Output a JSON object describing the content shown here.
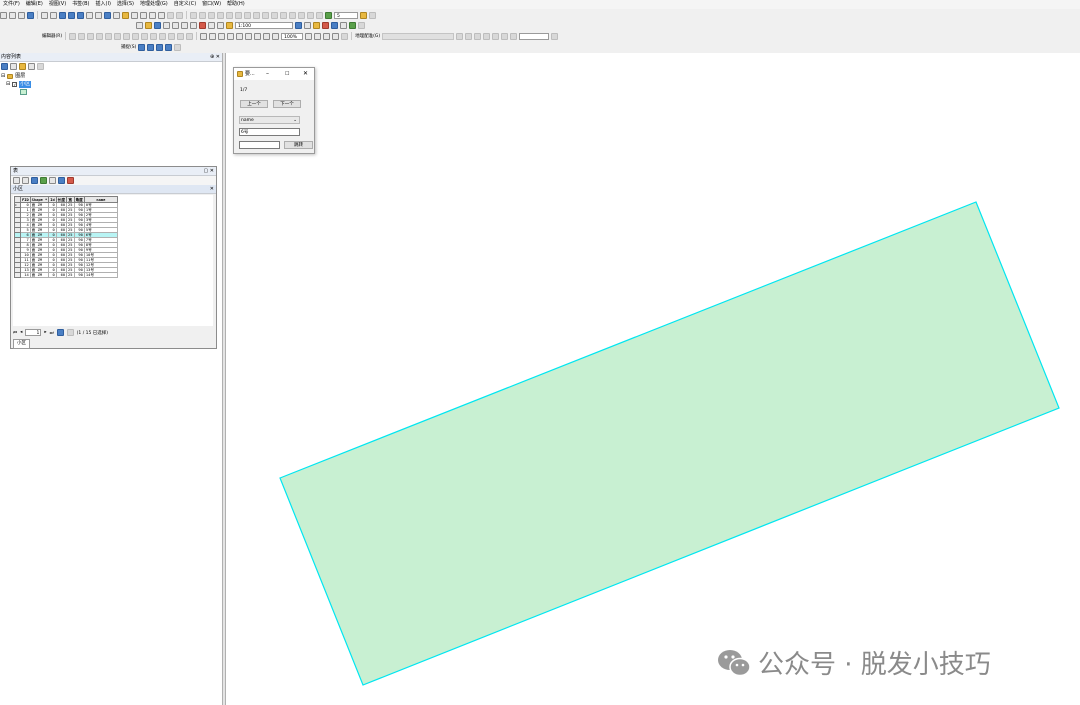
{
  "menu": [
    "文件(F)",
    "编辑(E)",
    "视图(V)",
    "书签(B)",
    "插入(I)",
    "选择(S)",
    "地理处理(G)",
    "自定义(C)",
    "窗口(W)",
    "帮助(H)"
  ],
  "toolbar": {
    "scale_value": "5",
    "scale_combo": "1:100",
    "editor_label": "编辑器(R)",
    "percent_value": "100%",
    "georef_label": "地理配准(G)",
    "capture_label": "捕捉(S)"
  },
  "toc": {
    "title": "内容列表",
    "group_label": "图层",
    "layer_label": "小区"
  },
  "table_window": {
    "title": "表",
    "layer_tab": "小区",
    "columns": [
      "FID",
      "Shape *",
      "Id",
      "长度",
      "宽",
      "角度",
      "name"
    ],
    "rows": [
      [
        "0",
        "面 ZM",
        "0",
        "60",
        "25",
        "90",
        "0号"
      ],
      [
        "1",
        "面 ZM",
        "0",
        "60",
        "25",
        "90",
        "1号"
      ],
      [
        "2",
        "面 ZM",
        "0",
        "60",
        "25",
        "90",
        "2号"
      ],
      [
        "3",
        "面 ZM",
        "0",
        "60",
        "25",
        "90",
        "3号"
      ],
      [
        "4",
        "面 ZM",
        "0",
        "60",
        "25",
        "90",
        "4号"
      ],
      [
        "5",
        "面 ZM",
        "0",
        "60",
        "25",
        "90",
        "5号"
      ],
      [
        "6",
        "面 ZM",
        "0",
        "60",
        "25",
        "90",
        "6号"
      ],
      [
        "7",
        "面 ZM",
        "0",
        "60",
        "25",
        "90",
        "7号"
      ],
      [
        "8",
        "面 ZM",
        "0",
        "60",
        "25",
        "90",
        "8号"
      ],
      [
        "9",
        "面 ZM",
        "0",
        "60",
        "25",
        "90",
        "9号"
      ],
      [
        "10",
        "面 ZM",
        "0",
        "60",
        "25",
        "90",
        "10号"
      ],
      [
        "11",
        "面 ZM",
        "0",
        "60",
        "25",
        "90",
        "11号"
      ],
      [
        "12",
        "面 ZM",
        "0",
        "60",
        "25",
        "90",
        "12号"
      ],
      [
        "13",
        "面 ZM",
        "0",
        "60",
        "25",
        "90",
        "13号"
      ],
      [
        "14",
        "面 ZM",
        "0",
        "60",
        "25",
        "90",
        "14号"
      ]
    ],
    "highlight_row": 6,
    "nav_record": "1",
    "status": "(1 / 15 已选择)"
  },
  "dialog": {
    "title": "要...",
    "counter": "1/7",
    "prev_label": "上一个",
    "next_label": "下一个",
    "field_select": "name",
    "value_text": "6号",
    "jump_label": "跳转",
    "jump_input": ""
  },
  "watermark": {
    "text": "公众号 · 脱发小技巧"
  },
  "colors": {
    "polygon_fill": "#c8f0d2",
    "polygon_stroke": "#00e6f0",
    "selection_row": "#b8f4f4",
    "selected_layer": "#3a8ee6"
  }
}
